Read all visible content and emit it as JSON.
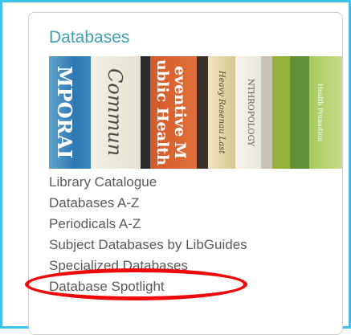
{
  "panel": {
    "title": "Databases",
    "banner_spines": [
      "MPORAI",
      "Commun",
      "ublic Health",
      "eventive M",
      "Heavy Rosenau Last",
      "NTHROPOLOGY",
      "Health Promotion"
    ]
  },
  "links": [
    {
      "label": "Library Catalogue"
    },
    {
      "label": "Databases A-Z"
    },
    {
      "label": "Periodicals A-Z"
    },
    {
      "label": "Subject Databases by LibGuides"
    },
    {
      "label": "Specialized Databases"
    },
    {
      "label": "Database Spotlight"
    }
  ],
  "highlight": {
    "target": "Specialized Databases",
    "color": "#ee0a0a"
  },
  "colors": {
    "frame": "#3fc1ee",
    "title": "#3f9fb1",
    "link": "#5a5a5a"
  }
}
